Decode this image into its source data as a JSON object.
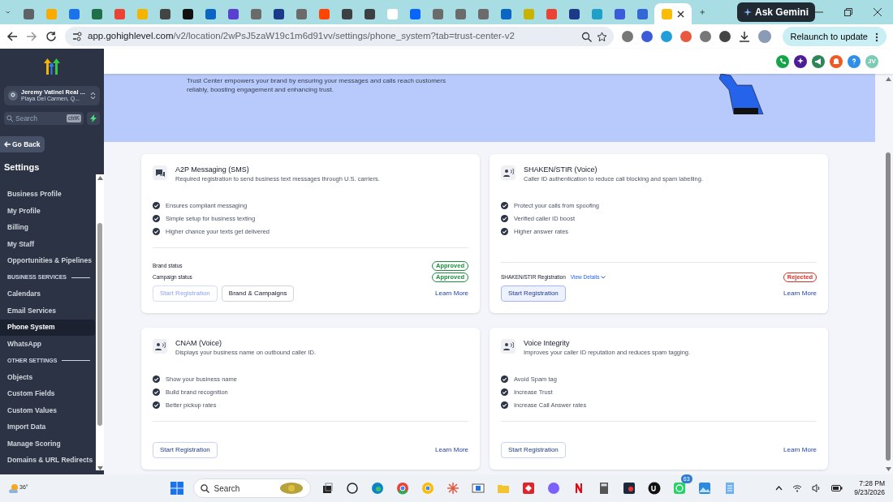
{
  "browser": {
    "tabs": [
      {
        "selected": false,
        "color": "#5f6368"
      },
      {
        "selected": false,
        "color": "#f9ab00"
      },
      {
        "selected": false,
        "color": "#1a73e8"
      },
      {
        "selected": false,
        "color": "#1f6f4a"
      },
      {
        "selected": false,
        "color": "#ea4335"
      },
      {
        "selected": false,
        "color": "#f4b400"
      },
      {
        "selected": false,
        "color": "#444444"
      },
      {
        "selected": false,
        "color": "#111111"
      },
      {
        "selected": false,
        "color": "#0a66c2"
      },
      {
        "selected": false,
        "color": "#5b3fd1"
      },
      {
        "selected": false,
        "color": "#6b6b6b"
      },
      {
        "selected": false,
        "color": "#1b3a8a"
      },
      {
        "selected": false,
        "color": "#6b6b6b"
      },
      {
        "selected": false,
        "color": "#ff4500"
      },
      {
        "selected": false,
        "color": "#3c4043"
      },
      {
        "selected": false,
        "color": "#3c4043"
      },
      {
        "selected": false,
        "color": "#ffffff"
      },
      {
        "selected": false,
        "color": "#0866ff"
      },
      {
        "selected": false,
        "color": "#6b6b6b"
      },
      {
        "selected": false,
        "color": "#6b6b6b"
      },
      {
        "selected": false,
        "color": "#6b6b6b"
      },
      {
        "selected": false,
        "color": "#0a66c2"
      },
      {
        "selected": false,
        "color": "#c8b400"
      },
      {
        "selected": false,
        "color": "#ea4335"
      },
      {
        "selected": false,
        "color": "#1b3a8a"
      },
      {
        "selected": false,
        "color": "#1ea0c8"
      },
      {
        "selected": false,
        "color": "#3b5bdb"
      },
      {
        "selected": false,
        "color": "#3367d6"
      },
      {
        "selected": true,
        "color": "#fbbc04"
      }
    ],
    "ask_gemini": "Ask Gemini",
    "url": "app.gohighlevel.com/v2/location/2wPsJ5zaW19c1m6d91vv/settings/phone_system?tab=trust-center-v2",
    "relaunch": "Relaunch to update"
  },
  "sidebar": {
    "account": {
      "name": "Jeremy Vatinel Real ...",
      "location": "Playa Del Carmen, Q..."
    },
    "search": {
      "placeholder": "Search",
      "shortcut": "ctrlK"
    },
    "back": "Go Back",
    "title": "Settings",
    "items": [
      {
        "kind": "link",
        "label": "Business Profile",
        "selected": false
      },
      {
        "kind": "link",
        "label": "My Profile",
        "selected": false
      },
      {
        "kind": "link",
        "label": "Billing",
        "selected": false
      },
      {
        "kind": "link",
        "label": "My Staff",
        "selected": false
      },
      {
        "kind": "link",
        "label": "Opportunities & Pipelines",
        "selected": false
      },
      {
        "kind": "section",
        "label": "BUSINESS SERVICES"
      },
      {
        "kind": "link",
        "label": "Calendars",
        "selected": false
      },
      {
        "kind": "link",
        "label": "Email Services",
        "selected": false
      },
      {
        "kind": "link",
        "label": "Phone System",
        "selected": true
      },
      {
        "kind": "link",
        "label": "WhatsApp",
        "selected": false
      },
      {
        "kind": "section",
        "label": "OTHER SETTINGS"
      },
      {
        "kind": "link",
        "label": "Objects",
        "selected": false
      },
      {
        "kind": "link",
        "label": "Custom Fields",
        "selected": false
      },
      {
        "kind": "link",
        "label": "Custom Values",
        "selected": false
      },
      {
        "kind": "link",
        "label": "Import Data",
        "selected": false
      },
      {
        "kind": "link",
        "label": "Manage Scoring",
        "selected": false
      },
      {
        "kind": "link",
        "label": "Domains & URL Redirects",
        "selected": false
      }
    ]
  },
  "header": {
    "avatar": "JV"
  },
  "banner": {
    "lines": [
      "Trust Center empowers your brand by ensuring your messages and calls reach customers",
      "reliably, boosting engagement and enhancing trust."
    ]
  },
  "cards": [
    {
      "kind": "chat",
      "title": "A2P Messaging (SMS)",
      "subtitle": "Required registration to send business text messages through U.S. carriers.",
      "features": [
        "Ensures compliant messaging",
        "Simple setup for business texting",
        "Higher chance your texts get delivered"
      ],
      "statuses": [
        {
          "label": "Brand status",
          "value": "Approved",
          "color": "#1e8e3e"
        },
        {
          "label": "Campaign status",
          "value": "Approved",
          "color": "#1e8e3e"
        }
      ],
      "buttons": [
        {
          "label": "Start Registration",
          "disabled": true,
          "highlighted": false
        },
        {
          "label": "Brand & Campaigns",
          "disabled": false,
          "highlighted": false
        }
      ],
      "learn_more": "Learn More"
    },
    {
      "kind": "voice",
      "title": "SHAKEN/STIR (Voice)",
      "subtitle": "Caller ID authentication to reduce call blocking and spam labelling.",
      "features": [
        "Protect your calls from spoofing",
        "Verified caller ID boost",
        "Higher answer rates"
      ],
      "registration": {
        "label": "SHAKEN/STIR Registration",
        "link": "View Details",
        "value": "Rejected",
        "color": "#d93025"
      },
      "buttons": [
        {
          "label": "Start Registration",
          "disabled": false,
          "highlighted": true
        }
      ],
      "learn_more": "Learn More"
    },
    {
      "kind": "voice",
      "title": "CNAM (Voice)",
      "subtitle": "Displays your business name on outbound caller ID.",
      "features": [
        "Show your business name",
        "Build brand recognition",
        "Better pickup rates"
      ],
      "buttons": [
        {
          "label": "Start Registration",
          "disabled": false,
          "highlighted": false
        }
      ],
      "learn_more": "Learn More"
    },
    {
      "kind": "voice",
      "title": "Voice Integrity",
      "subtitle": "Improves your caller ID reputation and reduces spam tagging.",
      "features": [
        "Avoid Spam tag",
        "Increase Trust",
        "Increase Call Answer rates"
      ],
      "buttons": [
        {
          "label": "Start Registration",
          "disabled": false,
          "highlighted": false
        }
      ],
      "learn_more": "Learn More"
    }
  ],
  "taskbar": {
    "weather": "36°",
    "search": "Search",
    "badge": "63",
    "time": "7:28 PM",
    "date": "9/23/2026"
  }
}
